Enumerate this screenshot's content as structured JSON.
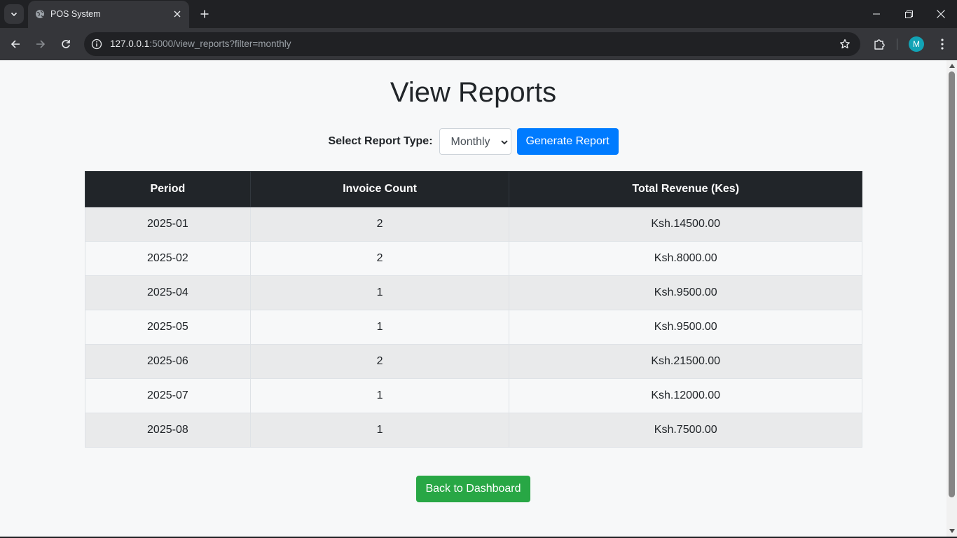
{
  "browser": {
    "tab_title": "POS System",
    "url_host": "127.0.0.1",
    "url_path": ":5000/view_reports?filter=monthly",
    "profile_initial": "M"
  },
  "page": {
    "title": "View Reports",
    "filter_label": "Select Report Type:",
    "selected_report_type": "Monthly",
    "generate_button": "Generate Report",
    "back_button": "Back to Dashboard"
  },
  "table": {
    "headers": [
      "Period",
      "Invoice Count",
      "Total Revenue (Kes)"
    ],
    "rows": [
      [
        "2025-01",
        "2",
        "Ksh.14500.00"
      ],
      [
        "2025-02",
        "2",
        "Ksh.8000.00"
      ],
      [
        "2025-04",
        "1",
        "Ksh.9500.00"
      ],
      [
        "2025-05",
        "1",
        "Ksh.9500.00"
      ],
      [
        "2025-06",
        "2",
        "Ksh.21500.00"
      ],
      [
        "2025-07",
        "1",
        "Ksh.12000.00"
      ],
      [
        "2025-08",
        "1",
        "Ksh.7500.00"
      ]
    ]
  },
  "colors": {
    "primary": "#007bff",
    "success": "#28a745",
    "table_header": "#212529"
  }
}
